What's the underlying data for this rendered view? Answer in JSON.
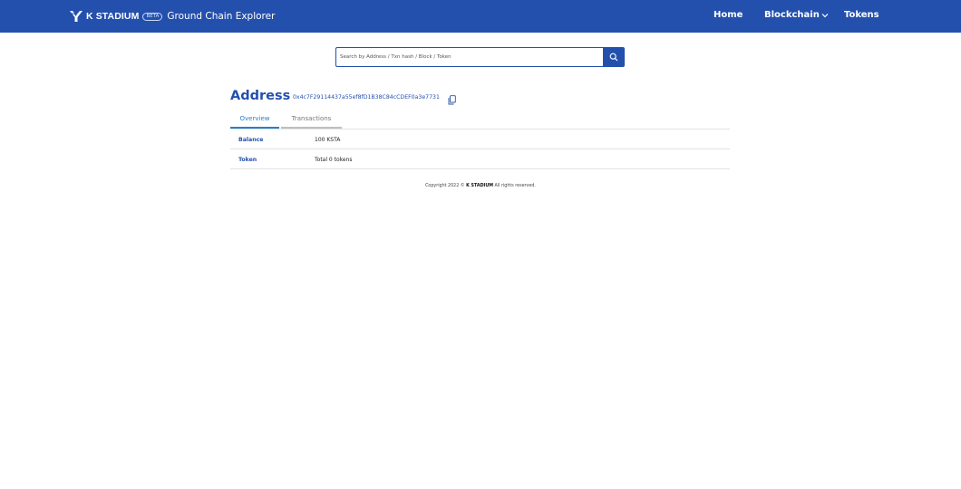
{
  "header": {
    "logo_text": "K STADIUM",
    "badge": "BETA",
    "title": "Ground Chain Explorer",
    "nav": {
      "home": "Home",
      "blockchain": "Blockchain",
      "tokens": "Tokens"
    },
    "colors": {
      "background": "#2450ad",
      "text": "#ffffff"
    }
  },
  "search": {
    "placeholder": "Search by Address / Txn hash / Block / Token",
    "value": "",
    "button_icon": "search-icon"
  },
  "address": {
    "title": "Address",
    "hash": "0x4c7F29114437a55ef8fD1B38C84cCDEF0a3e7731",
    "copy_icon": "copy-icon"
  },
  "tabs": [
    {
      "label": "Overview",
      "active": true
    },
    {
      "label": "Transactions",
      "active": false
    }
  ],
  "details": {
    "balance": {
      "label": "Balance",
      "value": "100 KSTA"
    },
    "token": {
      "label": "Token",
      "value": "Total 0 tokens"
    }
  },
  "footer": {
    "prefix": "Copyright 2022 © ",
    "brand": "K STADIUM",
    "suffix": " All rights reserved."
  }
}
